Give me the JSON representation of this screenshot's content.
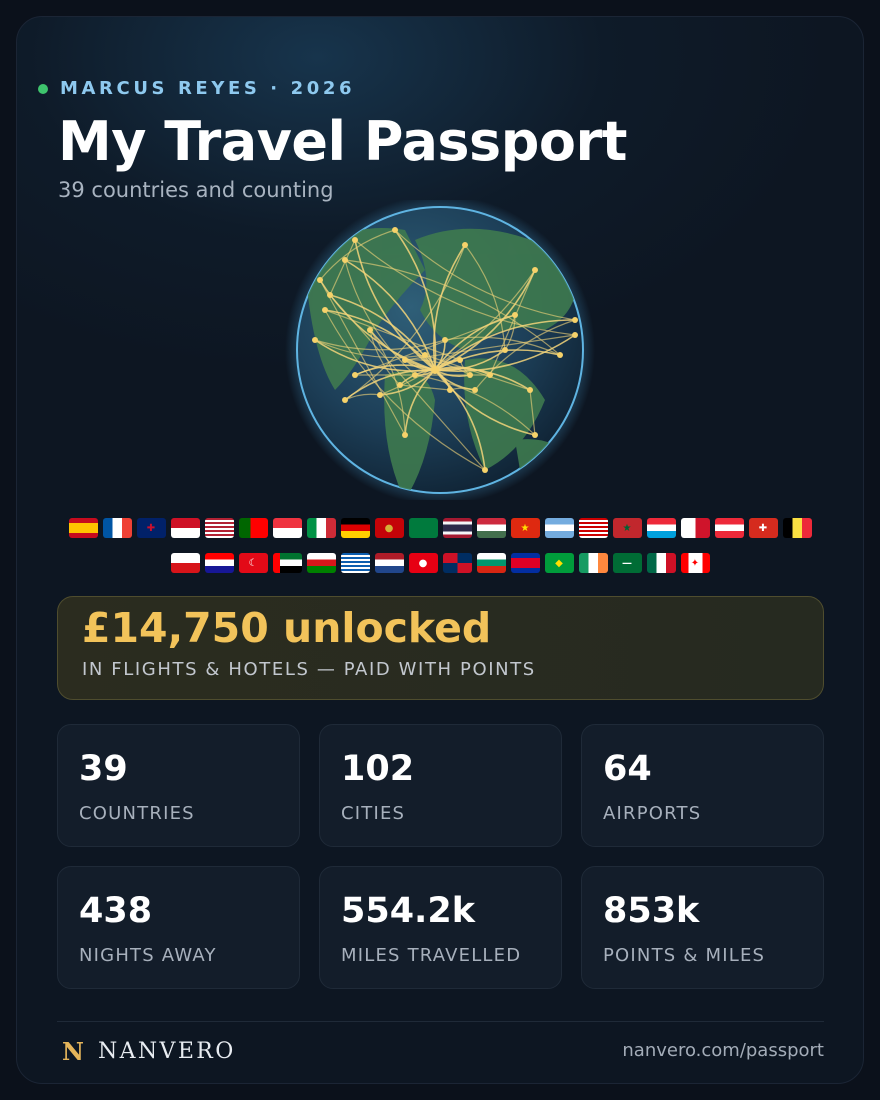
{
  "header": {
    "eyebrow": "MARCUS REYES · 2026",
    "title": "My Travel Passport",
    "subtitle": "39 countries and counting"
  },
  "flags_row1": [
    {
      "name": "spain-flag",
      "bg": "linear-gradient(#c60b1e 25%, #ffc400 25%, #ffc400 75%, #c60b1e 75%)"
    },
    {
      "name": "france-flag",
      "bg": "linear-gradient(90deg, #0055a4 33%, #fff 33%, #fff 66%, #ef4135 66%)"
    },
    {
      "name": "uk-flag",
      "bg": "#012169",
      "glyph": "✚",
      "color": "#c8102e"
    },
    {
      "name": "indonesia-flag",
      "bg": "linear-gradient(#ce1126 50%, #fff 50%)"
    },
    {
      "name": "usa-flag",
      "bg": "repeating-linear-gradient(#b22234 0 2px, #fff 2px 4px)"
    },
    {
      "name": "portugal-flag",
      "bg": "linear-gradient(90deg, #006600 40%, #ff0000 40%)"
    },
    {
      "name": "singapore-flag",
      "bg": "linear-gradient(#ef3340 50%, #fff 50%)"
    },
    {
      "name": "italy-flag",
      "bg": "linear-gradient(90deg, #009246 33%, #fff 33%, #fff 66%, #ce2b37 66%)"
    },
    {
      "name": "germany-flag",
      "bg": "linear-gradient(#000 33%, #dd0000 33%, #dd0000 66%, #ffce00 66%)"
    },
    {
      "name": "montenegro-flag",
      "bg": "#c40308",
      "glyph": "●",
      "color": "#d4af37"
    },
    {
      "name": "seychelles-flag",
      "bg": "conic-gradient(from 200deg at 0% 100%, #003f87 0 30deg, #fcd856 30deg 55deg, #d62828 55deg 80deg, #fff 80deg 90deg, #007a3d 90deg)"
    },
    {
      "name": "thailand-flag",
      "bg": "linear-gradient(#a51931 17%, #f4f5f8 17%, #f4f5f8 33%, #2d2a4a 33%, #2d2a4a 67%, #f4f5f8 67%, #f4f5f8 83%, #a51931 83%)"
    },
    {
      "name": "hungary-flag",
      "bg": "linear-gradient(#cd2a3e 33%, #fff 33%, #fff 66%, #436f4d 66%)"
    },
    {
      "name": "china-flag",
      "bg": "#de2910",
      "glyph": "★",
      "color": "#ffde00"
    },
    {
      "name": "argentina-flag",
      "bg": "linear-gradient(#74acdf 33%, #fff 33%, #fff 66%, #74acdf 66%)"
    },
    {
      "name": "malaysia-flag",
      "bg": "repeating-linear-gradient(#cc0001 0 2px, #fff 2px 4px)"
    },
    {
      "name": "morocco-flag",
      "bg": "#c1272d",
      "glyph": "★",
      "color": "#006233"
    },
    {
      "name": "luxembourg-flag",
      "bg": "linear-gradient(#ed2939 33%, #fff 33%, #fff 66%, #00a1de 66%)"
    },
    {
      "name": "malta-flag",
      "bg": "linear-gradient(90deg, #fff 50%, #cf142b 50%)"
    },
    {
      "name": "austria-flag",
      "bg": "linear-gradient(#ed2939 33%, #fff 33%, #fff 66%, #ed2939 66%)"
    },
    {
      "name": "switzerland-flag",
      "bg": "#d52b1e",
      "glyph": "✚",
      "color": "#fff"
    },
    {
      "name": "belgium-flag",
      "bg": "linear-gradient(90deg, #000 33%, #fae042 33%, #fae042 66%, #ed2939 66%)"
    }
  ],
  "flags_row2": [
    {
      "name": "czechia-flag",
      "bg": "linear-gradient(#fff 50%, #d7141a 50%)"
    },
    {
      "name": "croatia-flag",
      "bg": "linear-gradient(#ff0000 33%, #fff 33%, #fff 66%, #171796 66%)"
    },
    {
      "name": "turkey-flag",
      "bg": "#e30a17",
      "glyph": "☾",
      "color": "#fff"
    },
    {
      "name": "uae-flag",
      "bg": "linear-gradient(90deg, #ff0000 25%, transparent 25%), linear-gradient(#00732f 33%, #fff 33%, #fff 66%, #000 66%)"
    },
    {
      "name": "oman-flag",
      "bg": "linear-gradient(#fff 33%, #db161b 33%, #db161b 66%, #008000 66%)"
    },
    {
      "name": "greece-flag",
      "bg": "repeating-linear-gradient(#0d5eaf 0 2px, #fff 2px 4px)"
    },
    {
      "name": "netherlands-flag",
      "bg": "linear-gradient(#ae1c28 33%, #fff 33%, #fff 66%, #21468b 66%)"
    },
    {
      "name": "tunisia-flag",
      "bg": "#e70013",
      "glyph": "●",
      "color": "#fff"
    },
    {
      "name": "dominican-republic-flag",
      "bg": "conic-gradient(#002d62 0 90deg, #ce1126 90deg 180deg, #002d62 180deg 270deg, #ce1126 270deg)"
    },
    {
      "name": "bulgaria-flag",
      "bg": "linear-gradient(#fff 33%, #00966e 33%, #00966e 66%, #d62612 66%)"
    },
    {
      "name": "cambodia-flag",
      "bg": "linear-gradient(#032ea1 25%, #e00025 25%, #e00025 75%, #032ea1 75%)"
    },
    {
      "name": "brazil-flag",
      "bg": "#009c3b",
      "glyph": "◆",
      "color": "#ffdf00"
    },
    {
      "name": "ireland-flag",
      "bg": "linear-gradient(90deg, #169b62 33%, #fff 33%, #fff 66%, #ff883e 66%)"
    },
    {
      "name": "saudi-arabia-flag",
      "bg": "#006c35",
      "glyph": "—",
      "color": "#fff"
    },
    {
      "name": "mexico-flag",
      "bg": "linear-gradient(90deg, #006847 33%, #fff 33%, #fff 66%, #ce1126 66%)"
    },
    {
      "name": "canada-flag",
      "bg": "linear-gradient(90deg, #ff0000 25%, #fff 25%, #fff 75%, #ff0000 75%)",
      "glyph": "✦",
      "color": "#ff0000"
    }
  ],
  "hero": {
    "amount": "£14,750 unlocked",
    "caption": "IN FLIGHTS & HOTELS — PAID WITH POINTS"
  },
  "stats": [
    {
      "value": "39",
      "label": "COUNTRIES"
    },
    {
      "value": "102",
      "label": "CITIES"
    },
    {
      "value": "64",
      "label": "AIRPORTS"
    },
    {
      "value": "438",
      "label": "NIGHTS AWAY"
    },
    {
      "value": "554.2k",
      "label": "MILES TRAVELLED"
    },
    {
      "value": "853k",
      "label": "POINTS & MILES"
    }
  ],
  "footer": {
    "logo": "N",
    "brand": "NANVERO",
    "url": "nanvero.com/passport"
  },
  "colors": {
    "accent_gold": "#f2c35a",
    "eyebrow_blue": "#8ec9ef",
    "status_dot": "#3ec46d",
    "route_line": "#f3d57a"
  }
}
